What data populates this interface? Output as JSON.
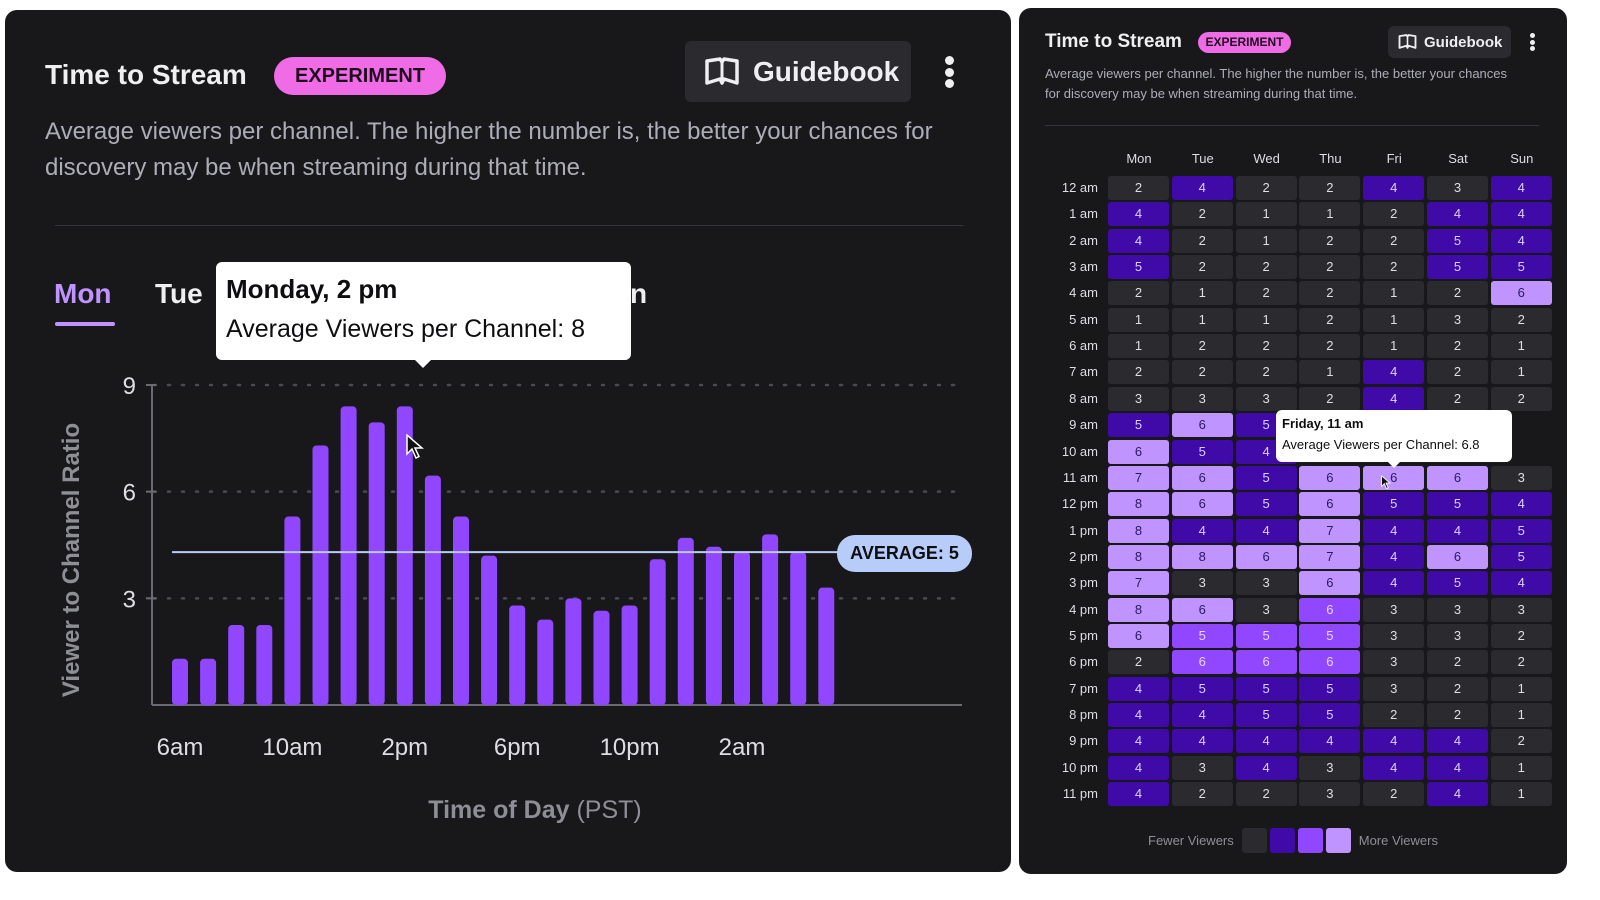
{
  "left": {
    "title": "Time to Stream",
    "badge": "EXPERIMENT",
    "guidebook_label": "Guidebook",
    "description": "Average viewers per channel. The higher the number is, the better your chances for discovery may be when streaming during that time.",
    "tabs": [
      {
        "label": "Mon",
        "active": true
      },
      {
        "label": "Tue",
        "active": false
      },
      {
        "label": "n",
        "active": false
      }
    ],
    "tooltip": {
      "title": "Monday, 2 pm",
      "body": "Average Viewers per Channel: 8"
    },
    "average_label": "AVERAGE: 5"
  },
  "chart_data": [
    {
      "type": "bar",
      "title": "Time to Stream",
      "xlabel": "Time of Day",
      "xlabel_suffix": "(PST)",
      "ylabel": "Viewer to Channel Ratio",
      "ylim": [
        0,
        9
      ],
      "yticks": [
        3,
        6,
        9
      ],
      "xtick_labels": [
        "6am",
        "10am",
        "2pm",
        "6pm",
        "10pm",
        "2am"
      ],
      "grid": "horizontal-dotted",
      "categories": [
        "6am",
        "7am",
        "8am",
        "9am",
        "10am",
        "11am",
        "12pm",
        "1pm",
        "2pm",
        "3pm",
        "4pm",
        "5pm",
        "6pm",
        "7pm",
        "8pm",
        "9pm",
        "10pm",
        "11pm",
        "12am",
        "1am",
        "2am",
        "3am",
        "4am",
        "5am"
      ],
      "values": [
        1.3,
        1.3,
        2.25,
        2.25,
        5.3,
        7.3,
        8.4,
        7.95,
        8.4,
        6.45,
        5.3,
        4.2,
        2.8,
        2.4,
        3.0,
        2.65,
        2.8,
        4.1,
        4.7,
        4.45,
        4.3,
        4.8,
        4.3,
        3.3
      ],
      "reference_line": {
        "value": 4.3,
        "label": "AVERAGE: 5"
      },
      "bar_color": "#9146ff"
    },
    {
      "type": "heatmap",
      "title": "Time to Stream",
      "columns": [
        "Mon",
        "Tue",
        "Wed",
        "Thu",
        "Fri",
        "Sat",
        "Sun"
      ],
      "rows": [
        "12 am",
        "1 am",
        "2 am",
        "3 am",
        "4 am",
        "5 am",
        "6 am",
        "7 am",
        "8 am",
        "9 am",
        "10 am",
        "11 am",
        "12 pm",
        "1 pm",
        "2 pm",
        "3 pm",
        "4 pm",
        "5 pm",
        "6 pm",
        "7 pm",
        "8 pm",
        "9 pm",
        "10 pm",
        "11 pm"
      ],
      "values": [
        [
          2,
          4,
          2,
          2,
          4,
          3,
          4
        ],
        [
          4,
          2,
          1,
          1,
          2,
          4,
          4
        ],
        [
          4,
          2,
          1,
          2,
          2,
          5,
          4
        ],
        [
          5,
          2,
          2,
          2,
          2,
          5,
          5
        ],
        [
          2,
          1,
          2,
          2,
          1,
          2,
          6
        ],
        [
          1,
          1,
          1,
          2,
          1,
          3,
          2
        ],
        [
          1,
          2,
          2,
          2,
          1,
          2,
          1
        ],
        [
          2,
          2,
          2,
          1,
          4,
          2,
          1
        ],
        [
          3,
          3,
          3,
          2,
          4,
          2,
          2
        ],
        [
          5,
          6,
          5,
          null,
          null,
          null,
          null
        ],
        [
          6,
          5,
          4,
          null,
          null,
          null,
          null
        ],
        [
          7,
          6,
          5,
          6,
          6,
          6,
          3
        ],
        [
          8,
          6,
          5,
          6,
          5,
          5,
          4
        ],
        [
          8,
          4,
          4,
          7,
          4,
          4,
          5
        ],
        [
          8,
          8,
          6,
          7,
          4,
          6,
          5
        ],
        [
          7,
          3,
          3,
          6,
          4,
          5,
          4
        ],
        [
          8,
          6,
          3,
          6,
          3,
          3,
          3
        ],
        [
          6,
          5,
          5,
          5,
          3,
          3,
          2
        ],
        [
          2,
          6,
          6,
          6,
          3,
          2,
          2
        ],
        [
          4,
          5,
          5,
          5,
          3,
          2,
          1
        ],
        [
          4,
          4,
          5,
          5,
          2,
          2,
          1
        ],
        [
          4,
          4,
          4,
          4,
          4,
          4,
          2
        ],
        [
          4,
          3,
          4,
          3,
          4,
          4,
          1
        ],
        [
          4,
          2,
          2,
          3,
          2,
          4,
          1
        ]
      ],
      "levels": [
        [
          0,
          1,
          0,
          0,
          1,
          0,
          1
        ],
        [
          1,
          0,
          0,
          0,
          0,
          1,
          1
        ],
        [
          1,
          0,
          0,
          0,
          0,
          1,
          1
        ],
        [
          1,
          0,
          0,
          0,
          0,
          1,
          1
        ],
        [
          0,
          0,
          0,
          0,
          0,
          0,
          3
        ],
        [
          0,
          0,
          0,
          0,
          0,
          0,
          0
        ],
        [
          0,
          0,
          0,
          0,
          0,
          0,
          0
        ],
        [
          0,
          0,
          0,
          0,
          1,
          0,
          0
        ],
        [
          0,
          0,
          0,
          0,
          1,
          0,
          0
        ],
        [
          1,
          3,
          1,
          0,
          0,
          0,
          0
        ],
        [
          3,
          1,
          1,
          0,
          0,
          0,
          0
        ],
        [
          3,
          3,
          1,
          3,
          3,
          3,
          0
        ],
        [
          3,
          3,
          1,
          3,
          1,
          1,
          1
        ],
        [
          3,
          1,
          1,
          3,
          1,
          1,
          1
        ],
        [
          3,
          3,
          3,
          3,
          1,
          3,
          1
        ],
        [
          3,
          0,
          0,
          3,
          1,
          1,
          1
        ],
        [
          3,
          3,
          0,
          2,
          0,
          0,
          0
        ],
        [
          3,
          2,
          2,
          2,
          0,
          0,
          0
        ],
        [
          0,
          2,
          2,
          2,
          0,
          0,
          0
        ],
        [
          1,
          1,
          1,
          1,
          0,
          0,
          0
        ],
        [
          1,
          1,
          1,
          1,
          0,
          0,
          0
        ],
        [
          1,
          1,
          1,
          1,
          1,
          1,
          0
        ],
        [
          1,
          0,
          1,
          0,
          1,
          1,
          0
        ],
        [
          1,
          0,
          0,
          0,
          0,
          1,
          0
        ]
      ],
      "level_colors": [
        "#2a2a2f",
        "#3f0aa8",
        "#9146ff",
        "#bf94ff"
      ],
      "legend": {
        "low_label": "Fewer Viewers",
        "high_label": "More Viewers"
      }
    }
  ],
  "right": {
    "title": "Time to Stream",
    "badge": "EXPERIMENT",
    "guidebook_label": "Guidebook",
    "description": "Average viewers per channel. The higher the number is, the better your chances for discovery may be when streaming during that time.",
    "tooltip": {
      "title": "Friday, 11 am",
      "body": "Average Viewers per Channel: 6.8"
    },
    "legend_low": "Fewer Viewers",
    "legend_high": "More Viewers"
  },
  "icons": {
    "guidebook": "open-book-icon",
    "menu": "kebab-menu-icon"
  }
}
